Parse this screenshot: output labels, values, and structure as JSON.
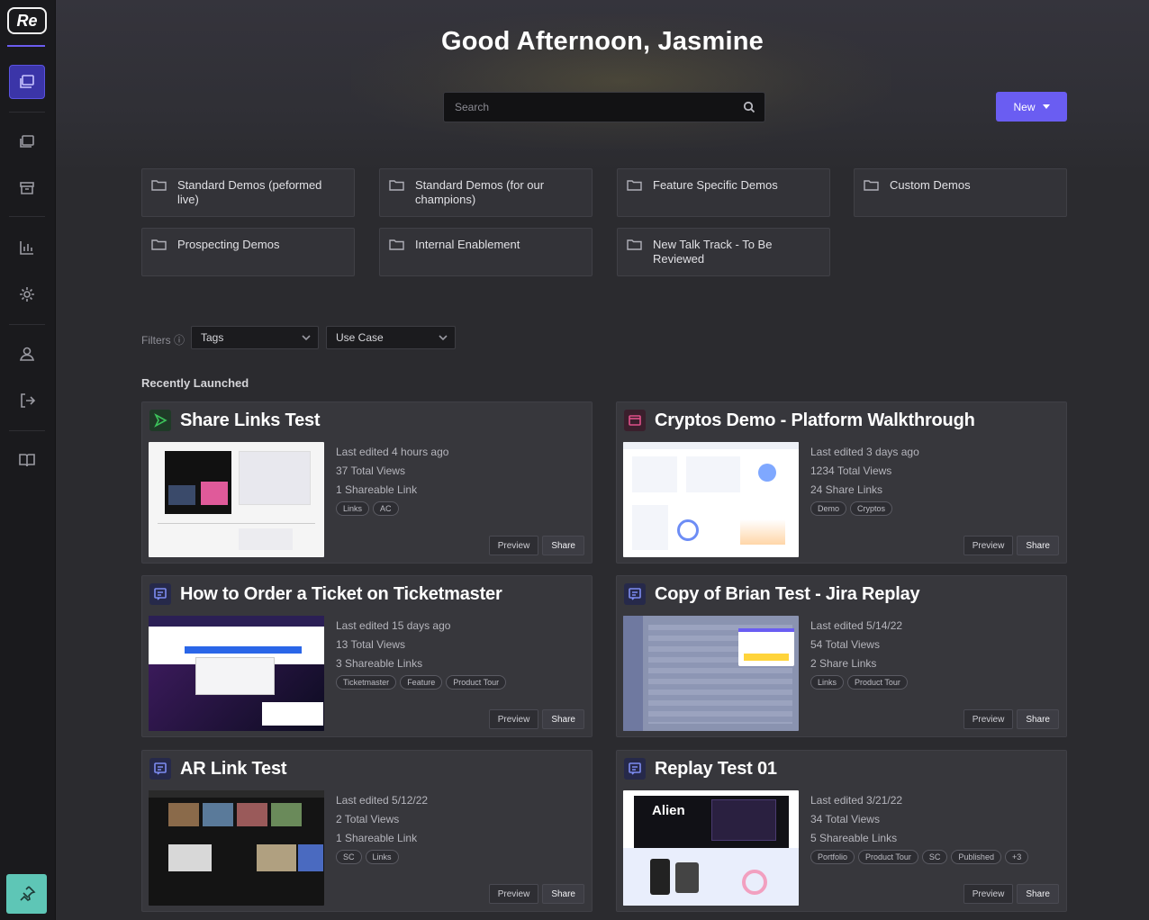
{
  "app": {
    "logo_text": "Re"
  },
  "sidebar": {
    "items": [
      {
        "name": "demos-icon",
        "active": true
      },
      {
        "name": "library-icon",
        "active": false
      },
      {
        "name": "archive-icon",
        "active": false
      },
      {
        "name": "analytics-icon",
        "active": false
      },
      {
        "name": "settings-icon",
        "active": false
      },
      {
        "name": "user-icon",
        "active": false
      },
      {
        "name": "logout-icon",
        "active": false
      },
      {
        "name": "book-icon",
        "active": false
      }
    ],
    "pin_icon": "pin-icon"
  },
  "header": {
    "greeting": "Good Afternoon, Jasmine",
    "search_placeholder": "Search",
    "new_label": "New"
  },
  "folders": [
    {
      "label": "Standard Demos (peformed live)"
    },
    {
      "label": "Standard Demos (for our champions)"
    },
    {
      "label": "Feature Specific Demos"
    },
    {
      "label": "Custom Demos"
    },
    {
      "label": "Prospecting Demos"
    },
    {
      "label": "Internal Enablement"
    },
    {
      "label": "New Talk Track - To Be Reviewed"
    }
  ],
  "filters": {
    "label": "Filters",
    "tags_value": "Tags",
    "usecase_value": "Use Case"
  },
  "section_title": "Recently Launched",
  "cards": [
    {
      "title": "Share Links Test",
      "icon": "play-icon",
      "icon_color": "#2f9e44",
      "edited": "Last edited 4 hours ago",
      "views": "37 Total Views",
      "links": "1 Shareable Link",
      "tags": [
        "Links",
        "AC"
      ],
      "preview": "Preview",
      "share": "Share"
    },
    {
      "title": "Cryptos Demo - Platform Walkthrough",
      "icon": "window-icon",
      "icon_color": "#d63a7a",
      "edited": "Last edited 3 days ago",
      "views": "1234 Total Views",
      "links": "24 Share Links",
      "tags": [
        "Demo",
        "Cryptos"
      ],
      "preview": "Preview",
      "share": "Share"
    },
    {
      "title": "How to Order a Ticket on Ticketmaster",
      "icon": "chat-icon",
      "icon_color": "#5a6be0",
      "edited": "Last edited 15 days ago",
      "views": "13 Total Views",
      "links": "3 Shareable Links",
      "tags": [
        "Ticketmaster",
        "Feature",
        "Product Tour"
      ],
      "preview": "Preview",
      "share": "Share"
    },
    {
      "title": "Copy of Brian Test - Jira Replay",
      "icon": "chat-icon",
      "icon_color": "#5a6be0",
      "edited": "Last edited 5/14/22",
      "views": "54 Total Views",
      "links": "2 Share Links",
      "tags": [
        "Links",
        "Product Tour"
      ],
      "preview": "Preview",
      "share": "Share"
    },
    {
      "title": "AR Link Test",
      "icon": "chat-icon",
      "icon_color": "#5a6be0",
      "edited": "Last edited 5/12/22",
      "views": "2 Total Views",
      "links": "1 Shareable Link",
      "tags": [
        "SC",
        "Links"
      ],
      "preview": "Preview",
      "share": "Share"
    },
    {
      "title": "Replay Test 01",
      "icon": "chat-icon",
      "icon_color": "#5a6be0",
      "edited": "Last edited 3/21/22",
      "views": "34 Total Views",
      "links": "5 Shareable Links",
      "tags": [
        "Portfolio",
        "Product Tour",
        "SC",
        "Published",
        "+3"
      ],
      "thumb_text": "Alien",
      "preview": "Preview",
      "share": "Share"
    }
  ],
  "colors": {
    "accent": "#6a5df2",
    "background": "#2b2b2f",
    "sidebar": "#1a1a1d",
    "pin_button": "#5ec6b6"
  }
}
